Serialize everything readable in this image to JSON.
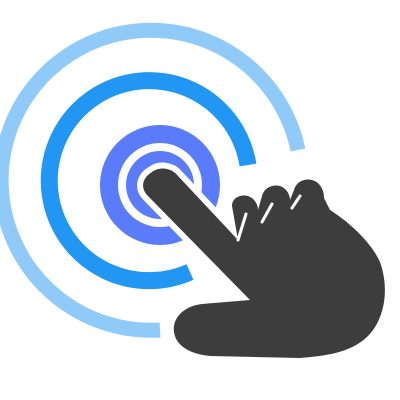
{
  "icon": {
    "name": "tap-gesture-icon",
    "description_colors": {
      "outer_ring": "#90CAF9",
      "middle_ring": "#2196F3",
      "inner_dot": "#5B7CFA",
      "hand": "#3D3D3D",
      "background": "#FFFFFF"
    }
  }
}
